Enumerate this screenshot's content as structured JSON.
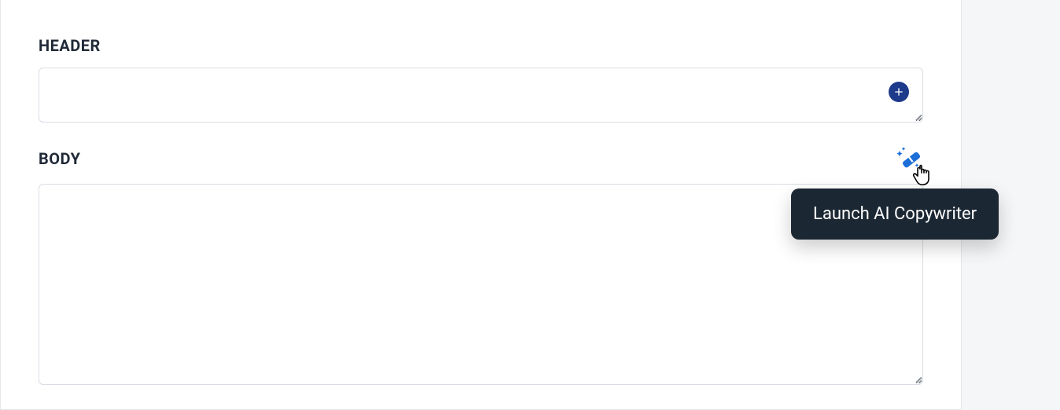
{
  "labels": {
    "header": "HEADER",
    "body": "BODY"
  },
  "fields": {
    "header_value": "",
    "body_value": ""
  },
  "tooltip": {
    "ai_copywriter": "Launch AI Copywriter"
  },
  "icons": {
    "plus": "plus-circle-icon",
    "wand": "magic-wand-icon",
    "cursor": "pointer-cursor-icon"
  },
  "colors": {
    "accent_dark_blue": "#1e3a8a",
    "accent_blue": "#1d6fd8",
    "text_dark": "#1f2937",
    "tooltip_bg": "#1b2733",
    "border": "#d9dde3"
  }
}
